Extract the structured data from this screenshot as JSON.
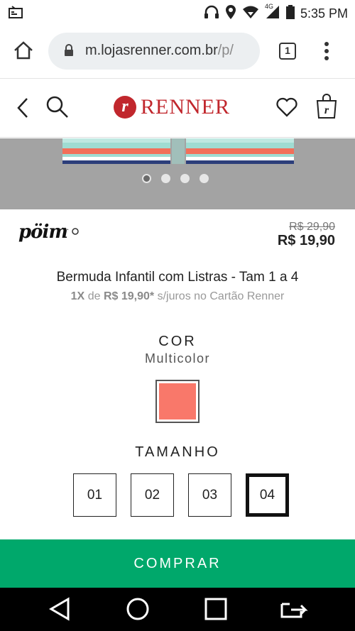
{
  "status_bar": {
    "time": "5:35 PM",
    "network": "4G",
    "icons": [
      "notification-icon",
      "headphones-icon",
      "location-icon",
      "wifi-icon",
      "signal-icon",
      "battery-icon"
    ]
  },
  "browser": {
    "url_host": "m.lojasrenner.com.br",
    "url_path": "/p/",
    "tab_count": "1",
    "icons": [
      "home-icon",
      "lock-icon",
      "tabs-icon",
      "menu-icon"
    ]
  },
  "store_header": {
    "logo_mark": "r",
    "logo_text": "RENNER",
    "icons": [
      "back-icon",
      "search-icon",
      "heart-icon",
      "bag-icon"
    ]
  },
  "product": {
    "brand": "pöim",
    "old_price": "R$ 29,90",
    "new_price": "R$ 19,90",
    "title": "Bermuda Infantil com Listras - Tam 1 a 4",
    "installments": {
      "count": "1X",
      "de": "de",
      "amount": "R$ 19,90*",
      "suffix": "s/juros no Cartão Renner"
    },
    "image_dots": 4,
    "active_dot": 0
  },
  "color": {
    "label": "COR",
    "value": "Multicolor",
    "swatch_color": "#f9786a"
  },
  "size": {
    "label": "TAMANHO",
    "options": [
      "01",
      "02",
      "03",
      "04"
    ],
    "selected": "04"
  },
  "buy": {
    "label": "COMPRAR",
    "color": "#00a86b"
  },
  "nav_bar": {
    "icons": [
      "nav-back-icon",
      "nav-home-icon",
      "nav-recent-icon",
      "nav-switch-icon"
    ]
  }
}
